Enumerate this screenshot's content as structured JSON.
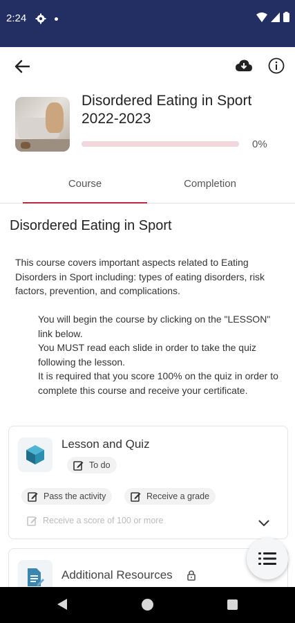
{
  "status_bar": {
    "time": "2:24"
  },
  "course": {
    "title": "Disordered Eating in Sport 2022-2023",
    "progress_label": "0%",
    "progress_fraction": 0
  },
  "tabs": [
    {
      "label": "Course",
      "active": true
    },
    {
      "label": "Completion",
      "active": false
    }
  ],
  "section": {
    "title": "Disordered Eating in Sport",
    "description": "This course covers important aspects related to Eating Disorders in Sport including: types of eating disorders, risk factors, prevention, and complications.",
    "instructions": [
      "You will begin the course by clicking on the \"LESSON\" link below.",
      "You MUST read each slide in order to take the quiz following the lesson.",
      "It is required that you score 100% on the quiz in order to complete this course and receive your certificate."
    ]
  },
  "activity": {
    "title": "Lesson and Quiz",
    "status": "To do",
    "conditions": {
      "pass": "Pass the activity",
      "grade": "Receive a grade",
      "score": "Receive a score of 100 or more"
    }
  },
  "resource": {
    "title": "Additional Resources"
  },
  "colors": {
    "accent": "#b8283f",
    "status_bar": "#232f62"
  }
}
